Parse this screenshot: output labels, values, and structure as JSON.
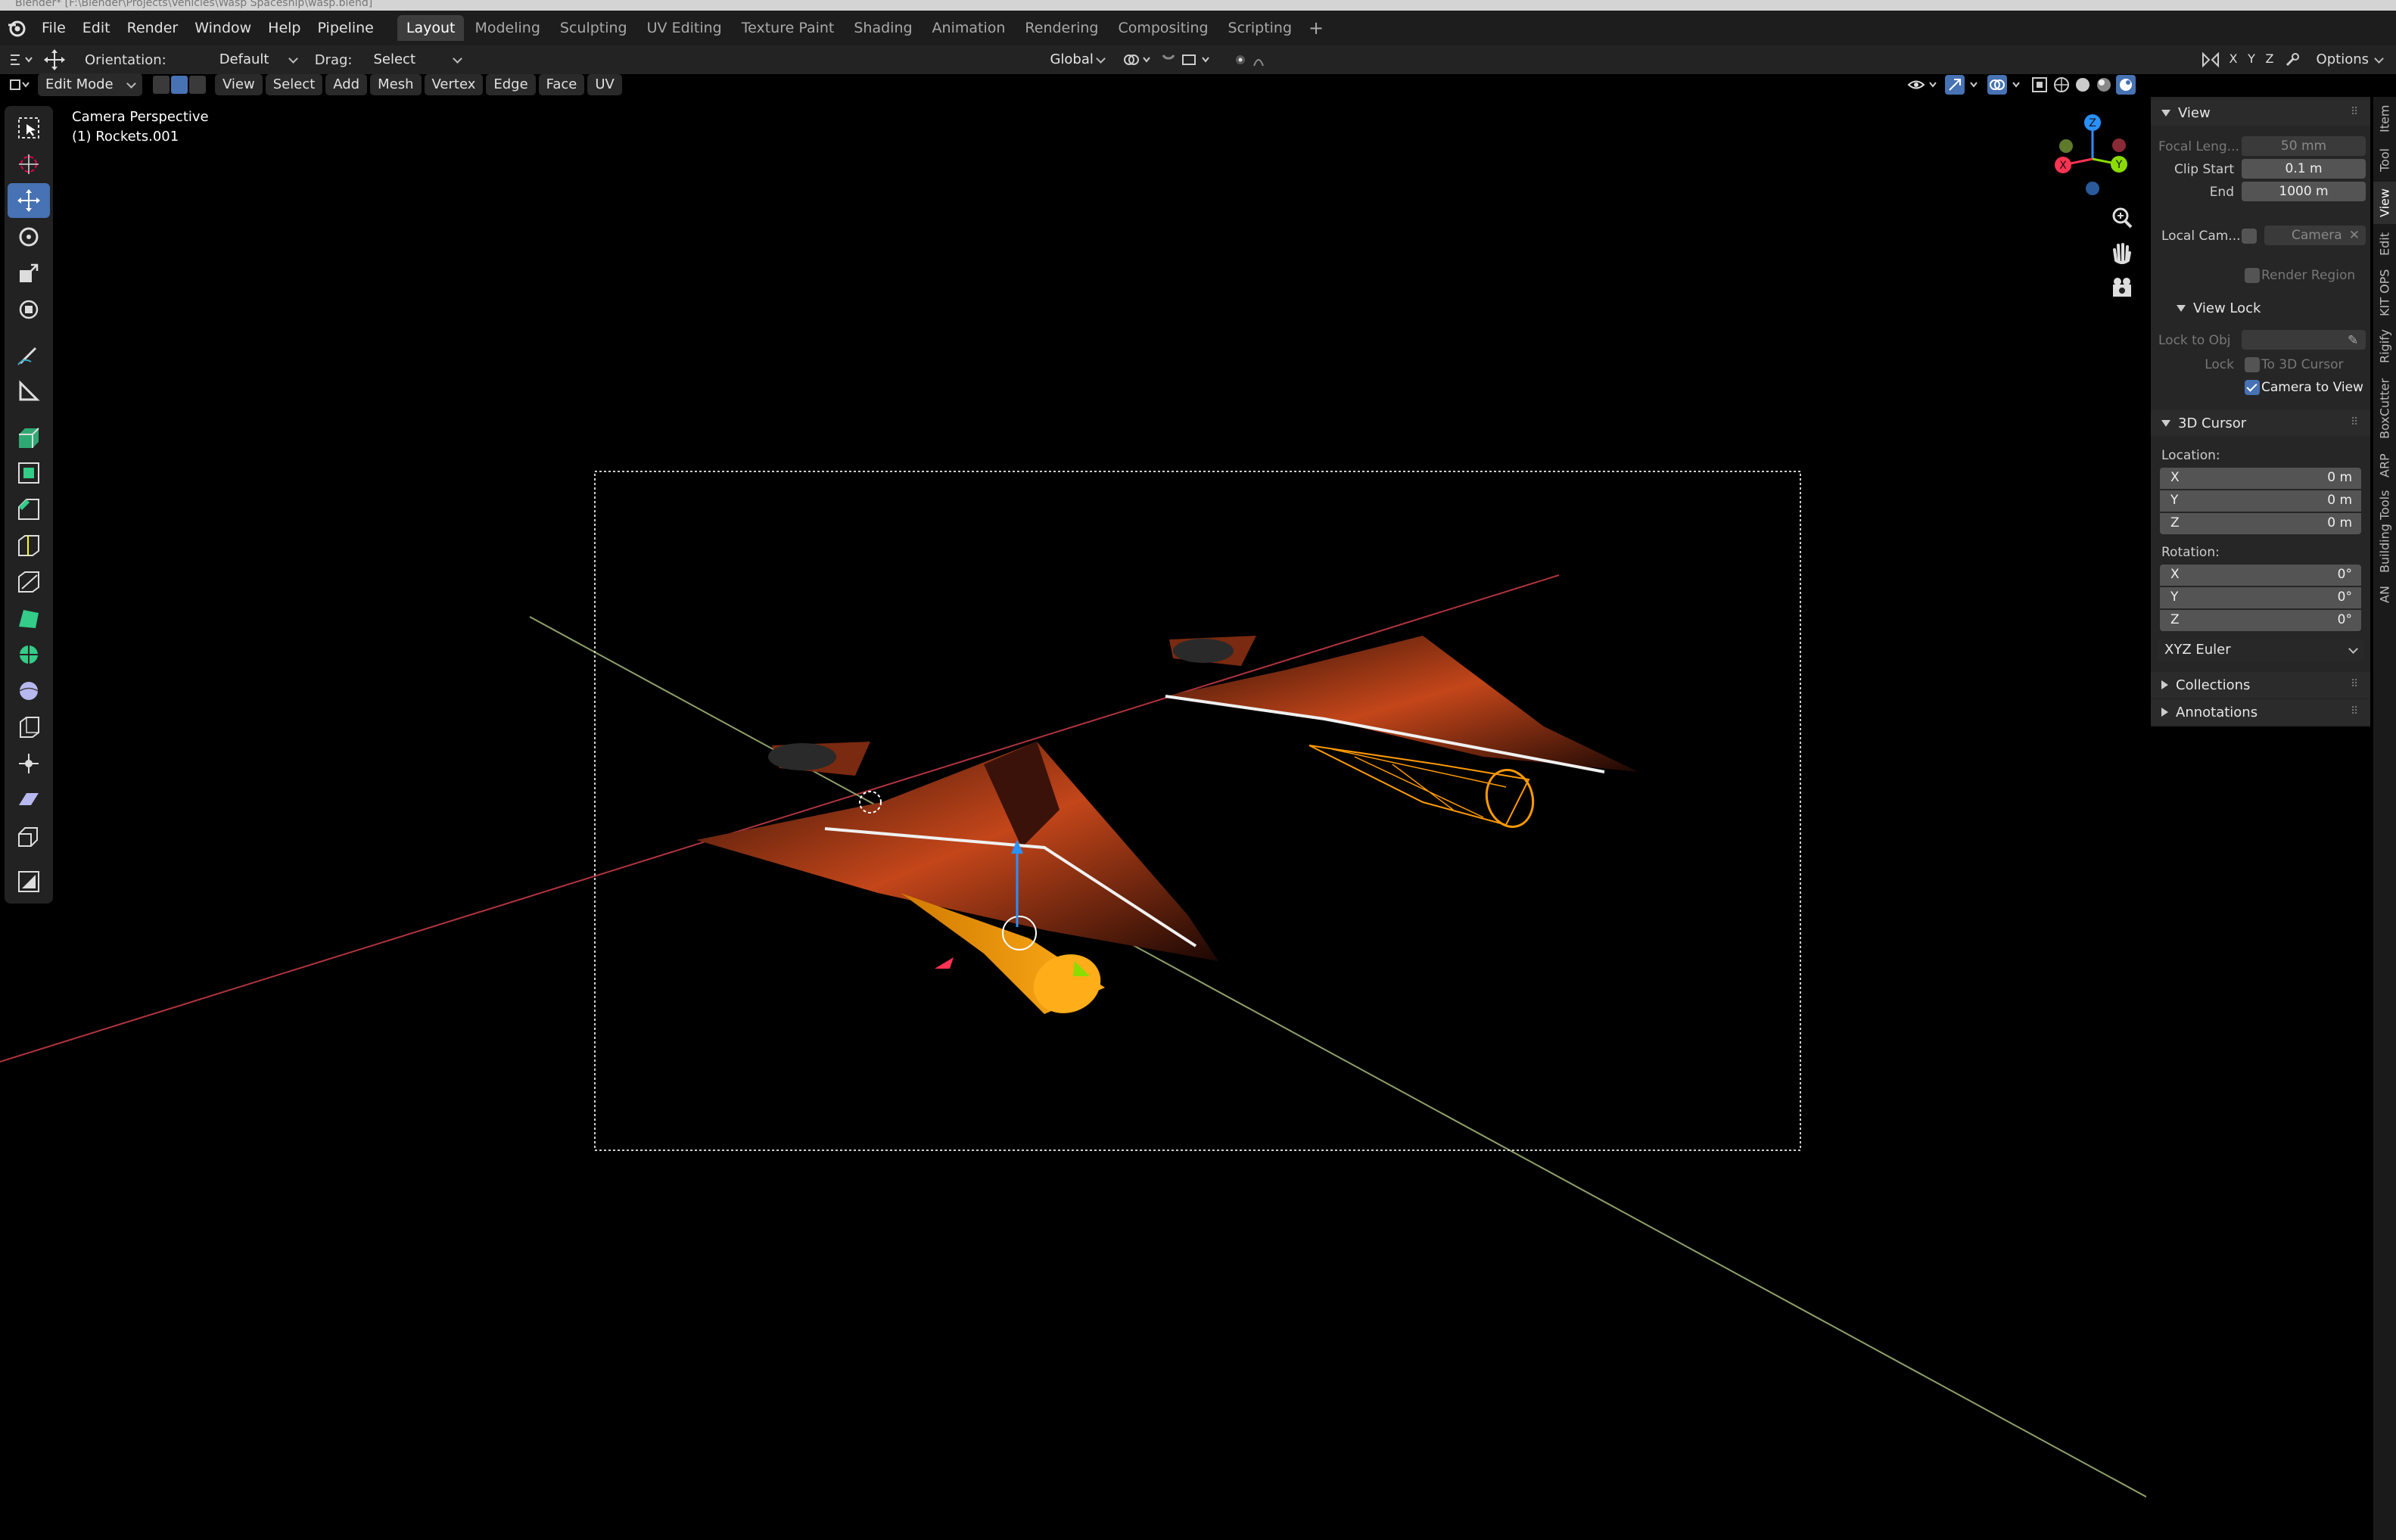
{
  "window": {
    "title": "Blender* [F:\\Blender\\Projects\\Vehicles\\Wasp Spaceship\\wasp.blend]"
  },
  "menu": [
    "File",
    "Edit",
    "Render",
    "Window",
    "Help",
    "Pipeline"
  ],
  "workspaces": [
    "Layout",
    "Modeling",
    "Sculpting",
    "UV Editing",
    "Texture Paint",
    "Shading",
    "Animation",
    "Rendering",
    "Compositing",
    "Scripting"
  ],
  "active_workspace": "Layout",
  "tool_header": {
    "orientation_label": "Orientation:",
    "orientation_value": "Default",
    "drag_label": "Drag:",
    "drag_value": "Select Box",
    "transform_orientation": "Global",
    "axes": [
      "X",
      "Y",
      "Z"
    ],
    "options_label": "Options"
  },
  "view_header": {
    "mode": "Edit Mode",
    "menus": [
      "View",
      "Select",
      "Add",
      "Mesh",
      "Vertex",
      "Edge",
      "Face",
      "UV"
    ]
  },
  "viewport": {
    "perspective": "Camera Perspective",
    "object": "(1) Rockets.001"
  },
  "gizmo_axes": {
    "x": "X",
    "y": "Y",
    "z": "Z"
  },
  "npanel": {
    "tabs": [
      "Item",
      "Tool",
      "View",
      "Edit",
      "KIT OPS",
      "Rigify",
      "BoxCutter",
      "ARP",
      "Building Tools",
      "AN"
    ],
    "active_tab": "View",
    "view_section": "View",
    "focal_length_label": "Focal Leng...",
    "focal_length_value": "50 mm",
    "clip_start_label": "Clip Start",
    "clip_start_value": "0.1 m",
    "end_label": "End",
    "end_value": "1000 m",
    "local_camera_label": "Local Cam...",
    "local_camera_value": "Camera",
    "render_region_label": "Render Region",
    "view_lock_section": "View Lock",
    "lock_to_obj_label": "Lock to Obj",
    "lock_label": "Lock",
    "to_3d_cursor_label": "To 3D Cursor",
    "camera_to_view_label": "Camera to View",
    "camera_to_view_checked": true,
    "cursor_section": "3D Cursor",
    "location_label": "Location:",
    "location": [
      {
        "axis": "X",
        "value": "0 m"
      },
      {
        "axis": "Y",
        "value": "0 m"
      },
      {
        "axis": "Z",
        "value": "0 m"
      }
    ],
    "rotation_label": "Rotation:",
    "rotation": [
      {
        "axis": "X",
        "value": "0°"
      },
      {
        "axis": "Y",
        "value": "0°"
      },
      {
        "axis": "Z",
        "value": "0°"
      }
    ],
    "rotation_mode": "XYZ Euler",
    "collections_section": "Collections",
    "annotations_section": "Annotations"
  },
  "colors": {
    "accent": "#4772b3",
    "x_axis": "#ff3352",
    "y_axis": "#8bdc00",
    "z_axis": "#2890ff",
    "ship": "#e0561a",
    "selection": "#ff9a00"
  }
}
